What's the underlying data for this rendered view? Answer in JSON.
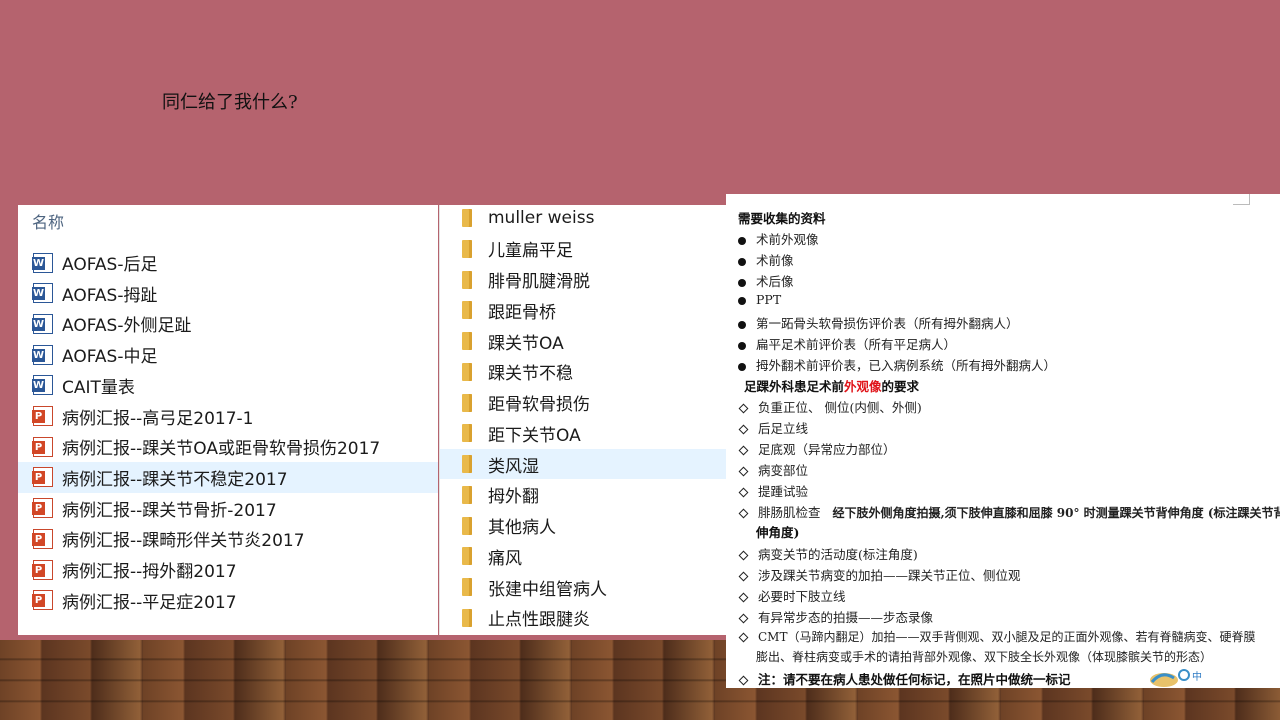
{
  "slide": {
    "title": "同仁给了我什么?"
  },
  "explorer": {
    "column_header": "名称",
    "files": [
      {
        "name": "AOFAS-后足",
        "type": "word"
      },
      {
        "name": "AOFAS-拇趾",
        "type": "word"
      },
      {
        "name": "AOFAS-外侧足趾",
        "type": "word"
      },
      {
        "name": "AOFAS-中足",
        "type": "word"
      },
      {
        "name": "CAIT量表",
        "type": "word"
      },
      {
        "name": "病例汇报--高弓足2017-1",
        "type": "ppt"
      },
      {
        "name": "病例汇报--踝关节OA或距骨软骨损伤2017",
        "type": "ppt"
      },
      {
        "name": "病例汇报--踝关节不稳定2017",
        "type": "ppt",
        "selected": true
      },
      {
        "name": "病例汇报--踝关节骨折-2017",
        "type": "ppt"
      },
      {
        "name": "病例汇报--踝畸形伴关节炎2017",
        "type": "ppt"
      },
      {
        "name": "病例汇报--拇外翻2017",
        "type": "ppt"
      },
      {
        "name": "病例汇报--平足症2017",
        "type": "ppt"
      }
    ],
    "folders": [
      {
        "name": "muller weiss"
      },
      {
        "name": "儿童扁平足"
      },
      {
        "name": "腓骨肌腱滑脱"
      },
      {
        "name": "跟距骨桥"
      },
      {
        "name": "踝关节OA"
      },
      {
        "name": "踝关节不稳"
      },
      {
        "name": "距骨软骨损伤"
      },
      {
        "name": "距下关节OA"
      },
      {
        "name": "类风湿",
        "selected": true
      },
      {
        "name": "拇外翻"
      },
      {
        "name": "其他病人"
      },
      {
        "name": "痛风"
      },
      {
        "name": "张建中组管病人"
      },
      {
        "name": "止点性跟腱炎"
      }
    ]
  },
  "document": {
    "heading1": "需要收集的资料",
    "list1": [
      "术前外观像",
      "术前像",
      "术后像",
      "PPT",
      "第一跖骨头软骨损伤评价表（所有拇外翻病人）",
      "扁平足术前评价表（所有平足病人）",
      "拇外翻术前评价表，已入病例系统（所有拇外翻病人）"
    ],
    "heading2_pre": "足踝外科患足术前",
    "heading2_red": "外观像",
    "heading2_post": "的要求",
    "list2": [
      "负重正位、 侧位(内侧、外侧)",
      "后足立线",
      "足底观（异常应力部位）",
      "病变部位",
      "提踵试验"
    ],
    "gastroc_label": "腓肠肌检查",
    "gastroc_text": "经下肢外侧角度拍摄,须下肢伸直膝和屈膝 90° 时测量踝关节背伸角度 (标注踝关节背",
    "gastroc_text2": "伸角度)",
    "list3": [
      "病变关节的活动度(标注角度)",
      "涉及踝关节病变的加拍——踝关节正位、侧位观",
      "必要时下肢立线",
      "有异常步态的拍摄——步态录像"
    ],
    "cmt_line1": "CMT（马蹄内翻足）加拍——双手背侧观、双小腿及足的正面外观像、若有脊髓病变、硬脊膜",
    "cmt_line2": "膨出、脊柱病变或手术的请拍背部外观像、双下肢全长外观像（体现膝髌关节的形态）",
    "note": "注：请不要在病人患处做任何标记，在照片中做统一标记",
    "logo_text": "中"
  }
}
